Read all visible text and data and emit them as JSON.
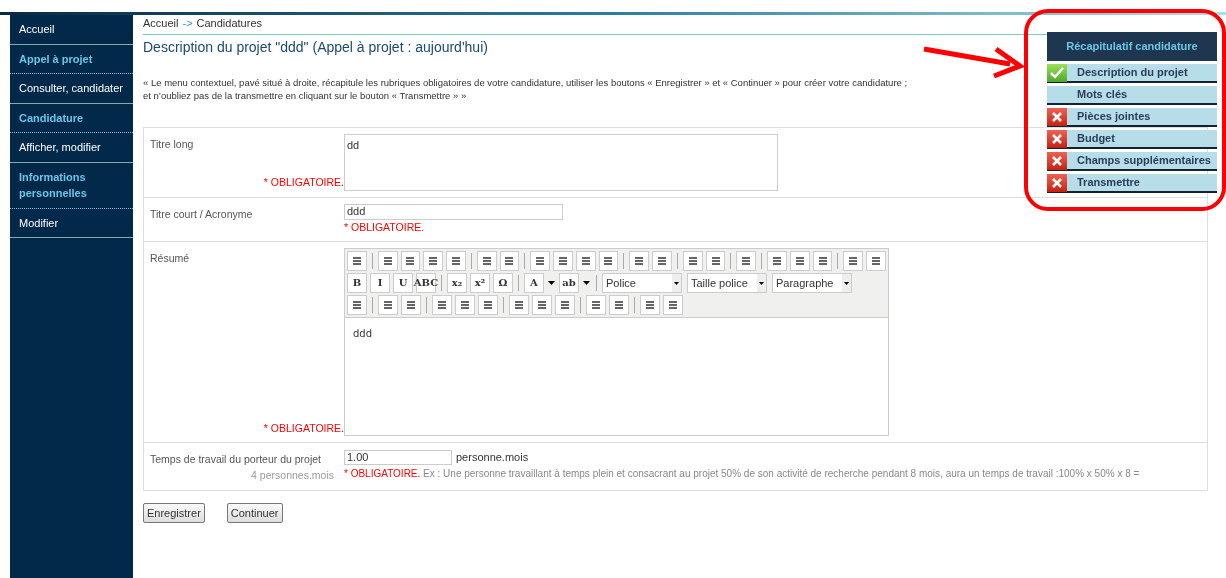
{
  "sidebar": {
    "items": [
      {
        "label": "Accueil",
        "kind": "link"
      },
      {
        "label": "Appel à projet",
        "kind": "heading"
      },
      {
        "label": "Consulter, candidater",
        "kind": "link"
      },
      {
        "label": "Candidature",
        "kind": "heading"
      },
      {
        "label": "Afficher, modifier",
        "kind": "link"
      },
      {
        "label": "Informations personnelles",
        "kind": "heading"
      },
      {
        "label": "Modifier",
        "kind": "link"
      }
    ]
  },
  "breadcrumb": {
    "items": [
      "Accueil",
      "Candidatures"
    ],
    "separator": "->"
  },
  "title": "Description du projet \"ddd\" (Appel à projet : aujourd'hui)",
  "intro": [
    "« Le menu contextuel, pavé situé à droite, récapitule les rubriques obligatoires de votre candidature, utiliser les boutons « Enregistrer » et « Continuer » pour créer votre candidature ;",
    "et n’oubliez pas de la transmettre en cliquant sur le bouton « Transmettre » »"
  ],
  "form": {
    "fields": [
      {
        "label": "Titre long",
        "kind": "textarea",
        "value": "dd",
        "required": "* OBLIGATOIRE."
      },
      {
        "label": "Titre court / Acronyme",
        "kind": "text",
        "value": "ddd",
        "required": "* OBLIGATOIRE."
      },
      {
        "label": "Résumé",
        "kind": "editor",
        "value": "ddd",
        "required": "* OBLIGATOIRE.",
        "toolbar": [
          [
            {
              "kind": "icon"
            },
            {
              "kind": "sep"
            },
            {
              "kind": "icon"
            },
            {
              "kind": "icon"
            },
            {
              "kind": "icon"
            },
            {
              "kind": "icon"
            },
            {
              "kind": "sep"
            },
            {
              "kind": "icon"
            },
            {
              "kind": "icon"
            },
            {
              "kind": "sep"
            },
            {
              "kind": "icon"
            },
            {
              "kind": "icon"
            },
            {
              "kind": "icon"
            },
            {
              "kind": "icon"
            },
            {
              "kind": "sep"
            },
            {
              "kind": "icon"
            },
            {
              "kind": "icon"
            },
            {
              "kind": "sep"
            },
            {
              "kind": "icon"
            },
            {
              "kind": "icon"
            },
            {
              "kind": "sep"
            },
            {
              "kind": "icon"
            },
            {
              "kind": "sep"
            },
            {
              "kind": "icon"
            },
            {
              "kind": "icon"
            },
            {
              "kind": "icon"
            },
            {
              "kind": "sep"
            },
            {
              "kind": "icon"
            },
            {
              "kind": "icon"
            }
          ],
          [
            {
              "kind": "button",
              "label": "B"
            },
            {
              "kind": "button",
              "label": "I"
            },
            {
              "kind": "button",
              "label": "U"
            },
            {
              "kind": "button",
              "label": "ABC"
            },
            {
              "kind": "sep"
            },
            {
              "kind": "button",
              "label": "x₂"
            },
            {
              "kind": "button",
              "label": "x²"
            },
            {
              "kind": "button",
              "label": "Ω"
            },
            {
              "kind": "sep"
            },
            {
              "kind": "button",
              "label": "A"
            },
            {
              "kind": "caret"
            },
            {
              "kind": "button",
              "label": "ab"
            },
            {
              "kind": "caret"
            },
            {
              "kind": "sep"
            },
            {
              "kind": "select",
              "label": "Police"
            },
            {
              "kind": "select",
              "label": "Taille police"
            },
            {
              "kind": "select",
              "label": "Paragraphe"
            }
          ],
          [
            {
              "kind": "icon"
            },
            {
              "kind": "sep"
            },
            {
              "kind": "icon"
            },
            {
              "kind": "icon"
            },
            {
              "kind": "sep"
            },
            {
              "kind": "icon"
            },
            {
              "kind": "icon"
            },
            {
              "kind": "icon"
            },
            {
              "kind": "sep"
            },
            {
              "kind": "icon"
            },
            {
              "kind": "icon"
            },
            {
              "kind": "icon"
            },
            {
              "kind": "sep"
            },
            {
              "kind": "icon"
            },
            {
              "kind": "icon"
            },
            {
              "kind": "sep"
            },
            {
              "kind": "icon"
            },
            {
              "kind": "icon"
            }
          ]
        ]
      },
      {
        "label": "Temps de travail du porteur du projet",
        "kind": "number",
        "value": "1.00",
        "unit": "personne.mois",
        "required": "* OBLIGATOIRE.",
        "hint": "Ex : Une personne travaillant à temps plein et consacrant au projet 50% de son activité de recherche pendant 8 mois, aura un temps de travail :100% x 50% x 8 =",
        "sublabel": "4 personnes.mois"
      }
    ]
  },
  "buttons": [
    "Enregistrer",
    "Continuer"
  ],
  "summary": {
    "title": "Récapitulatif candidature",
    "items": [
      {
        "label": "Description du projet",
        "kind": "done"
      },
      {
        "label": "Mots clés",
        "kind": "plain"
      },
      {
        "label": "Pièces jointes",
        "kind": "missing"
      },
      {
        "label": "Budget",
        "kind": "missing"
      },
      {
        "label": "Champs supplémentaires",
        "kind": "missing"
      },
      {
        "label": "Transmettre",
        "kind": "missing"
      }
    ]
  }
}
